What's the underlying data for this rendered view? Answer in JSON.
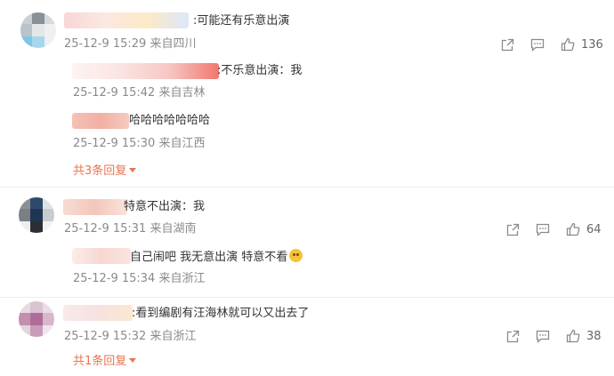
{
  "comments": [
    {
      "text": ":可能还有乐意出演",
      "meta": "25-12-9 15:29 来自四川",
      "likes": "136",
      "replies": [
        {
          "text": ":不乐意出演：我",
          "meta": "25-12-9 15:42 来自吉林"
        },
        {
          "text": "哈哈哈哈哈哈哈",
          "meta": "25-12-9 15:30 来自江西"
        }
      ],
      "more_replies": "共3条回复"
    },
    {
      "text": "特意不出演：我",
      "meta": "25-12-9 15:31 来自湖南",
      "likes": "64",
      "replies": [
        {
          "text": "自己闹吧 我无意出演 特意不看",
          "meta": "25-12-9 15:34 来自浙江"
        }
      ]
    },
    {
      "text": ":看到编剧有汪海林就可以又出去了",
      "meta": "25-12-9 15:32 来自浙江",
      "likes": "38",
      "replies": [],
      "more_replies": "共1条回复"
    }
  ],
  "icons": {
    "share": "share-icon",
    "comment": "comment-icon",
    "like": "thumbs-up-icon",
    "emoji": "laughing-emoji-icon"
  },
  "colors": {
    "accent": "#eb7350",
    "meta": "#8a8a8a",
    "divider": "#eeeeee"
  }
}
